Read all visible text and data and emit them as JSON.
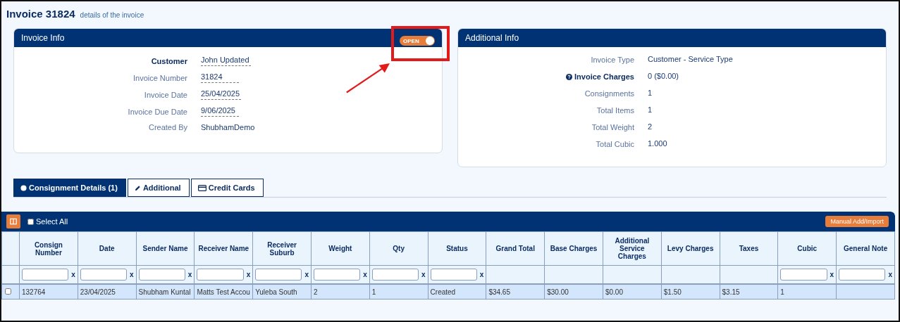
{
  "page": {
    "title": "Invoice 31824",
    "subtitle": "details of the invoice"
  },
  "invoice_info": {
    "title": "Invoice Info",
    "status_toggle": {
      "label": "OPEN",
      "on": true
    },
    "fields": [
      {
        "label": "Customer",
        "value": "John Updated",
        "kind": "strong",
        "editable": true
      },
      {
        "label": "Invoice Number",
        "value": "31824",
        "kind": "plain",
        "editable": true
      },
      {
        "label": "Invoice Date",
        "value": "25/04/2025",
        "kind": "plain",
        "editable": true
      },
      {
        "label": "Invoice Due Date",
        "value": "9/06/2025",
        "kind": "plain",
        "editable": true
      },
      {
        "label": "Created By",
        "value": "ShubhamDemo",
        "kind": "plain",
        "editable": false
      }
    ]
  },
  "additional_info": {
    "title": "Additional Info",
    "fields": [
      {
        "label": "Invoice Type",
        "value": "Customer - Service Type",
        "kind": "plain"
      },
      {
        "label": "Invoice Charges",
        "value": "0 ($0.00)",
        "kind": "help"
      },
      {
        "label": "Consignments",
        "value": "1",
        "kind": "plain"
      },
      {
        "label": "Total Items",
        "value": "1",
        "kind": "plain"
      },
      {
        "label": "Total Weight",
        "value": "2",
        "kind": "plain"
      },
      {
        "label": "Total Cubic",
        "value": "1.000",
        "kind": "plain"
      }
    ]
  },
  "tabs": [
    {
      "label": "Consignment Details (1)",
      "selected": true
    },
    {
      "label": "Additional",
      "selected": false
    },
    {
      "label": "Credit Cards",
      "selected": false
    }
  ],
  "table": {
    "select_all": {
      "label": "Select All",
      "checked": false
    },
    "action_button": "Manual Add/Import",
    "columns": [
      {
        "label": "Consign Number",
        "filter_clear": "x"
      },
      {
        "label": "Date",
        "filter_clear": "x"
      },
      {
        "label": "Sender Name",
        "filter_clear": "x"
      },
      {
        "label": "Receiver Name",
        "filter_clear": "x"
      },
      {
        "label": "Receiver Suburb",
        "filter_clear": "x"
      },
      {
        "label": "Weight",
        "filter_clear": "x"
      },
      {
        "label": "Qty",
        "filter_clear": "x"
      },
      {
        "label": "Status",
        "filter_clear": "x"
      },
      {
        "label": "Grand Total"
      },
      {
        "label": "Base Charges"
      },
      {
        "label": "Additional Service Charges"
      },
      {
        "label": "Levy Charges"
      },
      {
        "label": "Taxes"
      },
      {
        "label": "Cubic",
        "filter_clear": "x"
      },
      {
        "label": "General Note",
        "filter_clear": "x"
      }
    ],
    "rows": [
      {
        "checked": false,
        "cells": [
          "132764",
          "23/04/2025",
          "Shubham Kuntal",
          "Matts Test Accou",
          "Yuleba South",
          "2",
          "1",
          "Created",
          "$34.65",
          "$30.00",
          "$0.00",
          "$1.50",
          "$3.15",
          "1",
          ""
        ]
      }
    ]
  }
}
